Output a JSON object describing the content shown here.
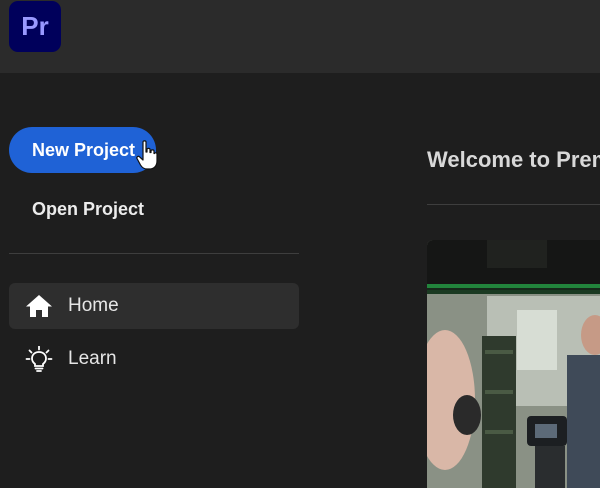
{
  "app": {
    "logo_text": "Pr",
    "logo_bg": "#00005b",
    "logo_fg": "#9999ff"
  },
  "sidebar": {
    "new_project_label": "New Project",
    "open_project_label": "Open Project",
    "nav": [
      {
        "label": "Home",
        "icon": "home-icon",
        "active": true
      },
      {
        "label": "Learn",
        "icon": "lightbulb-icon",
        "active": false
      }
    ]
  },
  "main": {
    "welcome_text": "Welcome to Premiere Pro"
  },
  "colors": {
    "accent": "#1f62d6",
    "background": "#1e1e1e",
    "topbar": "#2b2b2b"
  }
}
